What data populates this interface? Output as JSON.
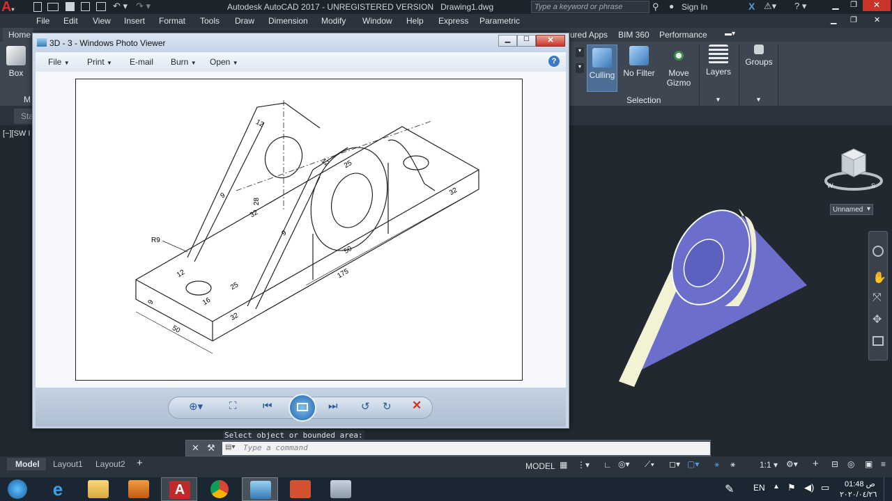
{
  "app": {
    "title": "Autodesk AutoCAD 2017 - UNREGISTERED VERSION   Drawing1.dwg",
    "search_placeholder": "Type a keyword or phrase",
    "sign_in": "Sign In"
  },
  "menu": [
    "File",
    "Edit",
    "View",
    "Insert",
    "Format",
    "Tools",
    "Draw",
    "Dimension",
    "Modify",
    "Window",
    "Help",
    "Express",
    "Parametric"
  ],
  "ribbon_tabs": {
    "home": "Home",
    "featured_apps": "ured Apps",
    "bim360": "BIM 360",
    "performance": "Performance"
  },
  "ribbon": {
    "box": "Box",
    "culling": "Culling",
    "no_filter": "No Filter",
    "move_gizmo_1": "Move",
    "move_gizmo_2": "Gizmo",
    "layers": "Layers",
    "groups": "Groups",
    "selection_panel": "Selection"
  },
  "left_labels": {
    "start": "Sta",
    "viewport": "[−][SW I",
    "m": "M"
  },
  "viewcube": {
    "named_view": "Unnamed",
    "w": "W",
    "s": "S"
  },
  "command": {
    "history": "Select object or bounded area:",
    "placeholder": "Type a command"
  },
  "layout_tabs": [
    "Model",
    "Layout1",
    "Layout2"
  ],
  "status": {
    "model": "MODEL",
    "scale": "1:1"
  },
  "taskbar": {
    "lang": "EN",
    "time": "01:48 ص",
    "date": "٢٠٢٠/٠٤/٢٦"
  },
  "viewer": {
    "title": "3D - 3 - Windows Photo Viewer",
    "menu": {
      "file": "File",
      "print": "Print",
      "email": "E-mail",
      "burn": "Burn",
      "open": "Open"
    }
  },
  "drawing_labels": {
    "d12_top": "12",
    "d12_mid": "12",
    "d25_top": "25",
    "d28": "28",
    "d9_left": "9",
    "d32_left": "32",
    "d9_mid": "9",
    "d32_right": "32",
    "r9": "R9",
    "d50_mid": "50",
    "d175": "175",
    "d12_base": "12",
    "d25_base": "25",
    "d16": "16",
    "d9_base": "9",
    "d32_base": "32",
    "d50_base": "50"
  },
  "colors": {
    "autocad_bg": "#212830",
    "ribbon": "#3d4651",
    "model_face": "#6b6fcb",
    "model_light": "#f2f2d4",
    "close_red": "#c9352b"
  }
}
